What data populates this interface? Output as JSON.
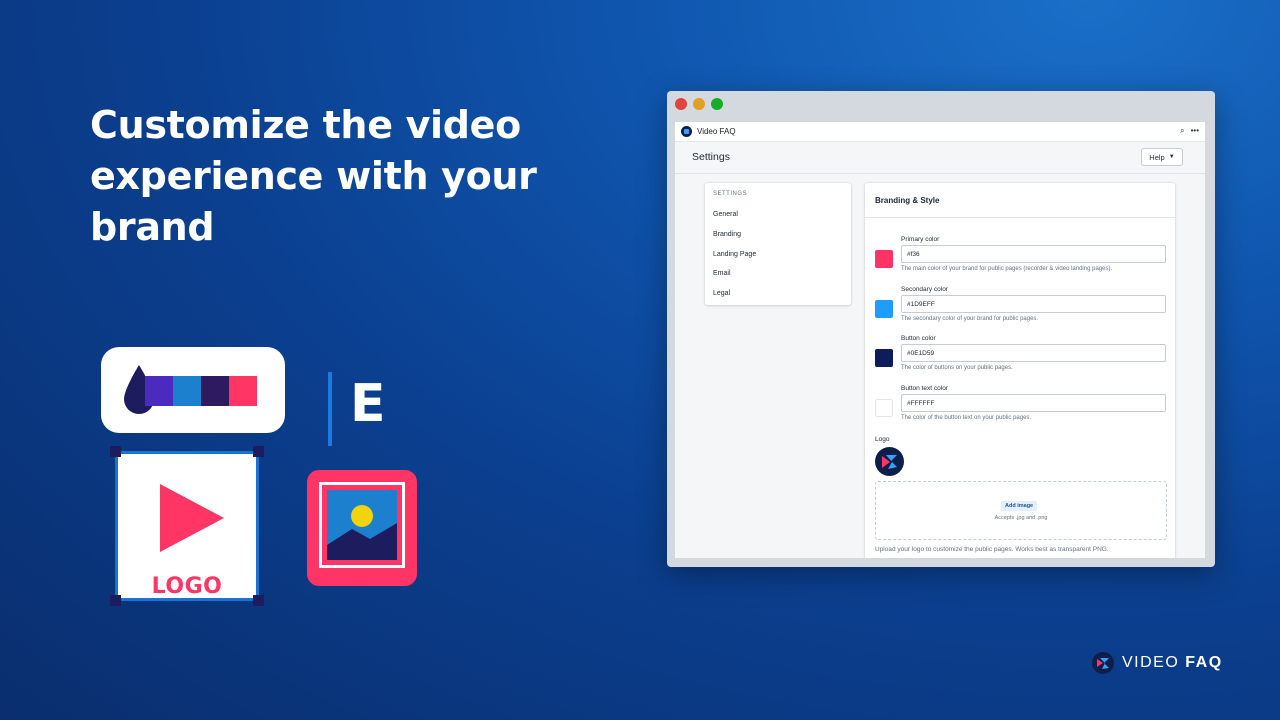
{
  "hero": {
    "headline": "Customize the video experience with your brand"
  },
  "illustration": {
    "palette_colors": [
      "#4b2bbf",
      "#1d80cf",
      "#2e1a5e",
      "#ff3566"
    ],
    "drop_color": "#1c1c5e",
    "letter": "E",
    "logo_text": "LOGO",
    "accent": "#ff3566"
  },
  "window": {
    "traffic_lights": [
      "#e0443e",
      "#dea123",
      "#1aab29"
    ],
    "app_name": "Video FAQ",
    "page_title": "Settings",
    "help_button": "Help",
    "sidenav": {
      "heading": "SETTINGS",
      "items": [
        "General",
        "Branding",
        "Landing Page",
        "Email",
        "Legal"
      ]
    },
    "card": {
      "title": "Branding & Style",
      "fields": [
        {
          "label": "Primary color",
          "value": "#f36",
          "swatch": "#ff3366",
          "help": "The main color of your brand for public pages (recorder & video landing pages)."
        },
        {
          "label": "Secondary color",
          "value": "#1D9EFF",
          "swatch": "#1d9eff",
          "help": "The secondary color of your brand for public pages."
        },
        {
          "label": "Button color",
          "value": "#0E1D59",
          "swatch": "#0e1d59",
          "help": "The color of buttons on your public pages."
        },
        {
          "label": "Button text color",
          "value": "#FFFFFF",
          "swatch": "#ffffff",
          "help": "The color of the button text on your public pages."
        }
      ],
      "logo_label": "Logo",
      "add_image": "Add image",
      "accepts": "Accepts .jpg and .png",
      "upload_note": "Upload your logo to customize the public pages. Works best as transparent PNG."
    }
  },
  "brand_footer": {
    "word_light": "VIDEO",
    "word_bold": "FAQ"
  }
}
